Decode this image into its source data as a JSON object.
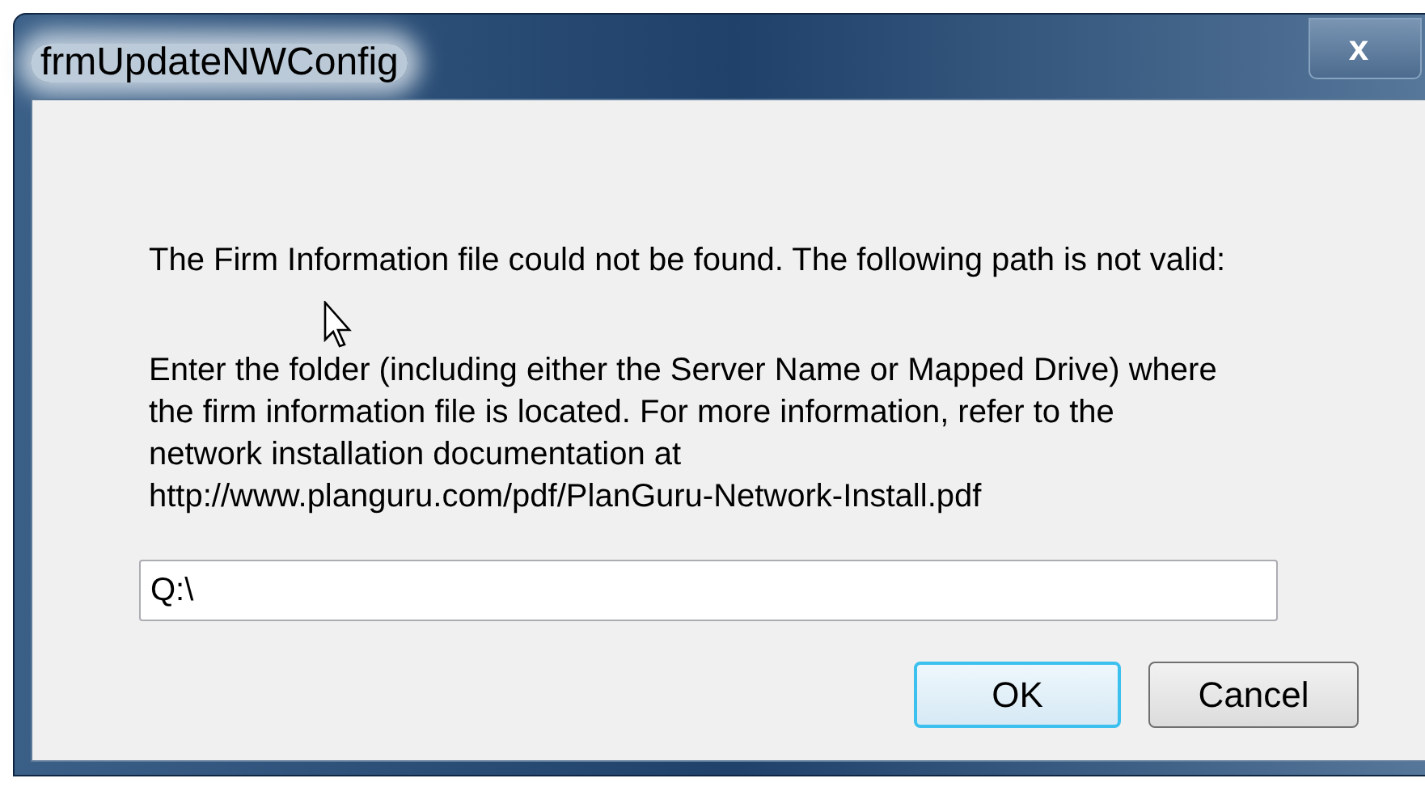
{
  "window": {
    "title": "frmUpdateNWConfig",
    "close": "x"
  },
  "message": "The Firm Information file could not be found. The following path is not valid:",
  "instructions": "Enter the folder (including either the Server Name or Mapped Drive) where the firm information file is located. For more information, refer to the network installation documentation at http://www.planguru.com/pdf/PlanGuru-Network-Install.pdf",
  "path_field": {
    "value": "Q:\\"
  },
  "buttons": [
    {
      "label": "OK",
      "default": true
    },
    {
      "label": "Cancel",
      "default": false
    }
  ]
}
